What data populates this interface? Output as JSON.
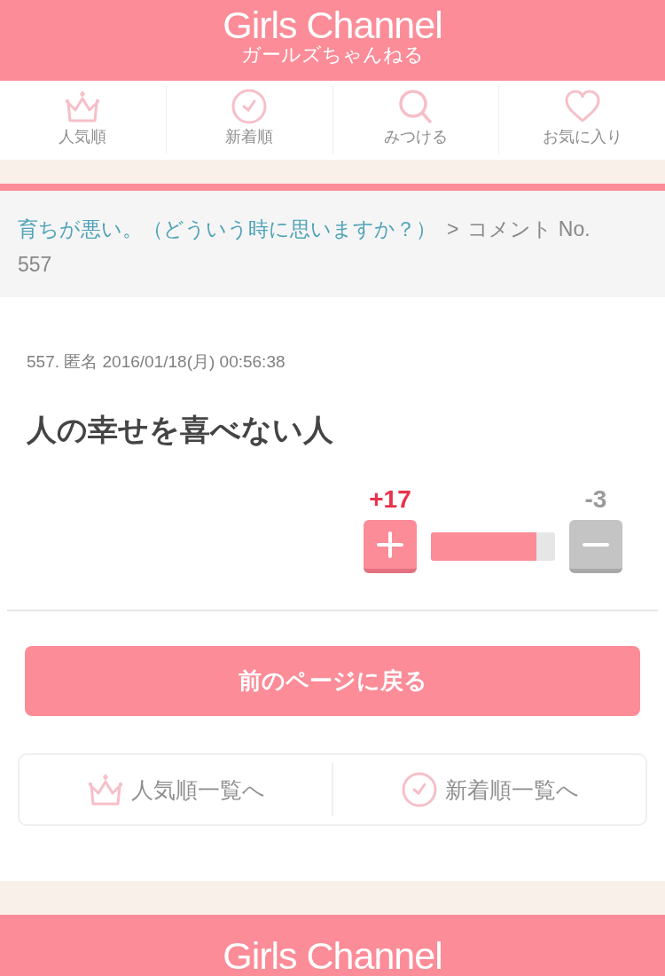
{
  "header": {
    "logo": "Girls Channel",
    "subtitle": "ガールズちゃんねる"
  },
  "nav": {
    "items": [
      {
        "kind": "crown",
        "label": "人気順"
      },
      {
        "kind": "clock",
        "label": "新着順"
      },
      {
        "kind": "search",
        "label": "みつける"
      },
      {
        "kind": "heart",
        "label": "お気に入り"
      }
    ]
  },
  "breadcrumb": {
    "link": "育ちが悪い。（どういう時に思いますか？）",
    "separator": ">",
    "current": "コメント No. 557"
  },
  "comment": {
    "meta": "557. 匿名 2016/01/18(月) 00:56:38",
    "body": "人の幸せを喜べない人",
    "plus_count": "+17",
    "minus_count": "-3",
    "level": 0.85
  },
  "back_button": "前のページに戻る",
  "list_links": [
    {
      "kind": "crown",
      "label": "人気順一覧へ"
    },
    {
      "kind": "clock",
      "label": "新着順一覧へ"
    }
  ],
  "footer": {
    "logo": "Girls Channel"
  }
}
